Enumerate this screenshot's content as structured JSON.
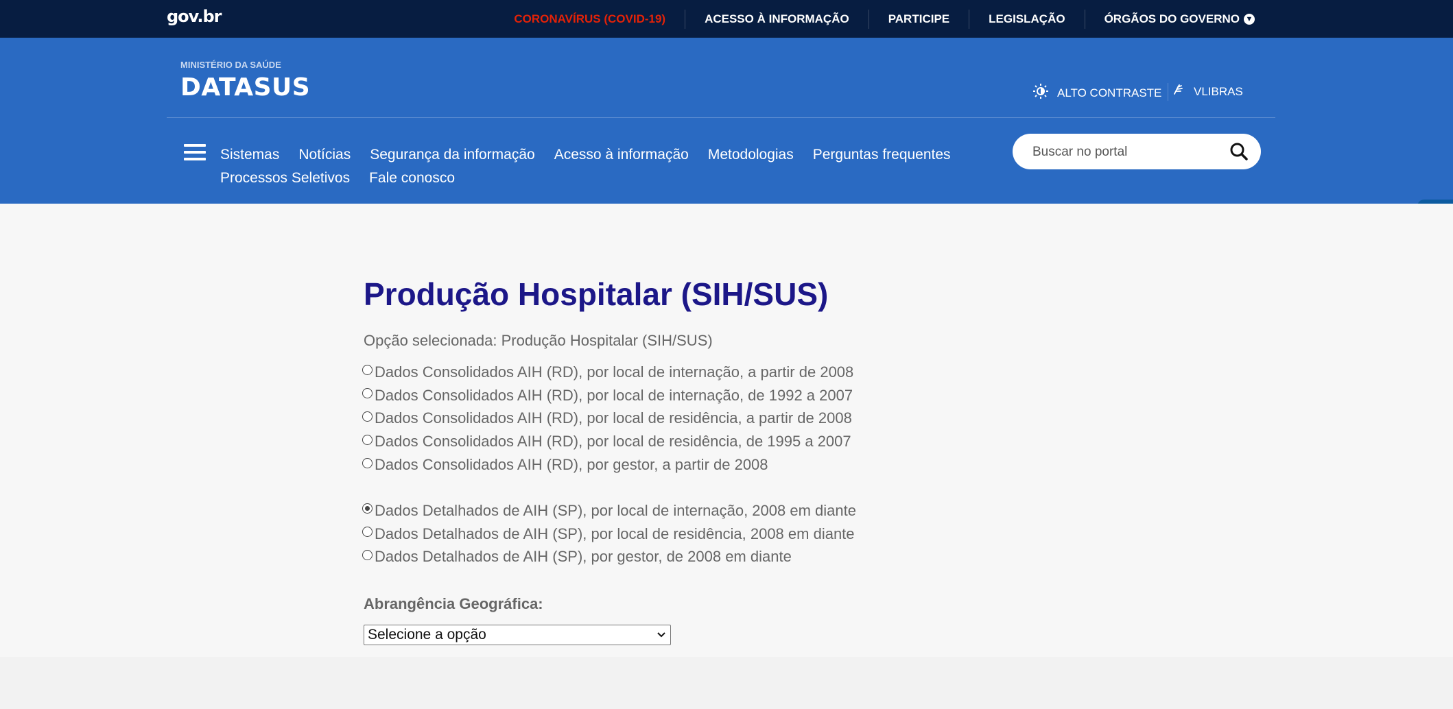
{
  "topbar": {
    "logo": "gov.br",
    "links": [
      "CORONAVÍRUS (COVID-19)",
      "ACESSO À INFORMAÇÃO",
      "PARTICIPE",
      "LEGISLAÇÃO",
      "ÓRGÃOS DO GOVERNO"
    ]
  },
  "header": {
    "ministry": "MINISTÉRIO DA SAÚDE",
    "brand": "DATASUS",
    "high_contrast": "ALTO CONTRASTE",
    "vlibras": "VLIBRAS",
    "nav": [
      "Sistemas",
      "Notícias",
      "Segurança da informação",
      "Acesso à informação",
      "Metodologias",
      "Perguntas frequentes",
      "Processos Seletivos",
      "Fale conosco"
    ],
    "search_placeholder": "Buscar no portal"
  },
  "main": {
    "title": "Produção Hospitalar (SIH/SUS)",
    "selected_option": "Opção selecionada: Produção Hospitalar (SIH/SUS)",
    "consolidated": [
      "Dados Consolidados AIH (RD), por local de internação, a partir de 2008",
      "Dados Consolidados AIH (RD), por local de internação, de 1992 a 2007",
      "Dados Consolidados AIH (RD), por local de residência, a partir de 2008",
      "Dados Consolidados AIH (RD), por local de residência, de 1995 a 2007",
      "Dados Consolidados AIH (RD), por gestor, a partir de 2008"
    ],
    "detailed": [
      "Dados Detalhados de AIH (SP), por local de internação, 2008 em diante",
      "Dados Detalhados de AIH (SP), por local de residência, 2008 em diante",
      "Dados Detalhados de AIH (SP), por gestor, de 2008 em diante"
    ],
    "geo_label": "Abrangência Geográfica:",
    "geo_select_value": "Selecione a opção"
  },
  "colors": {
    "topbar": "#071d41",
    "header": "#2a6ac2",
    "title": "#1c1788",
    "covid": "#e52207"
  }
}
